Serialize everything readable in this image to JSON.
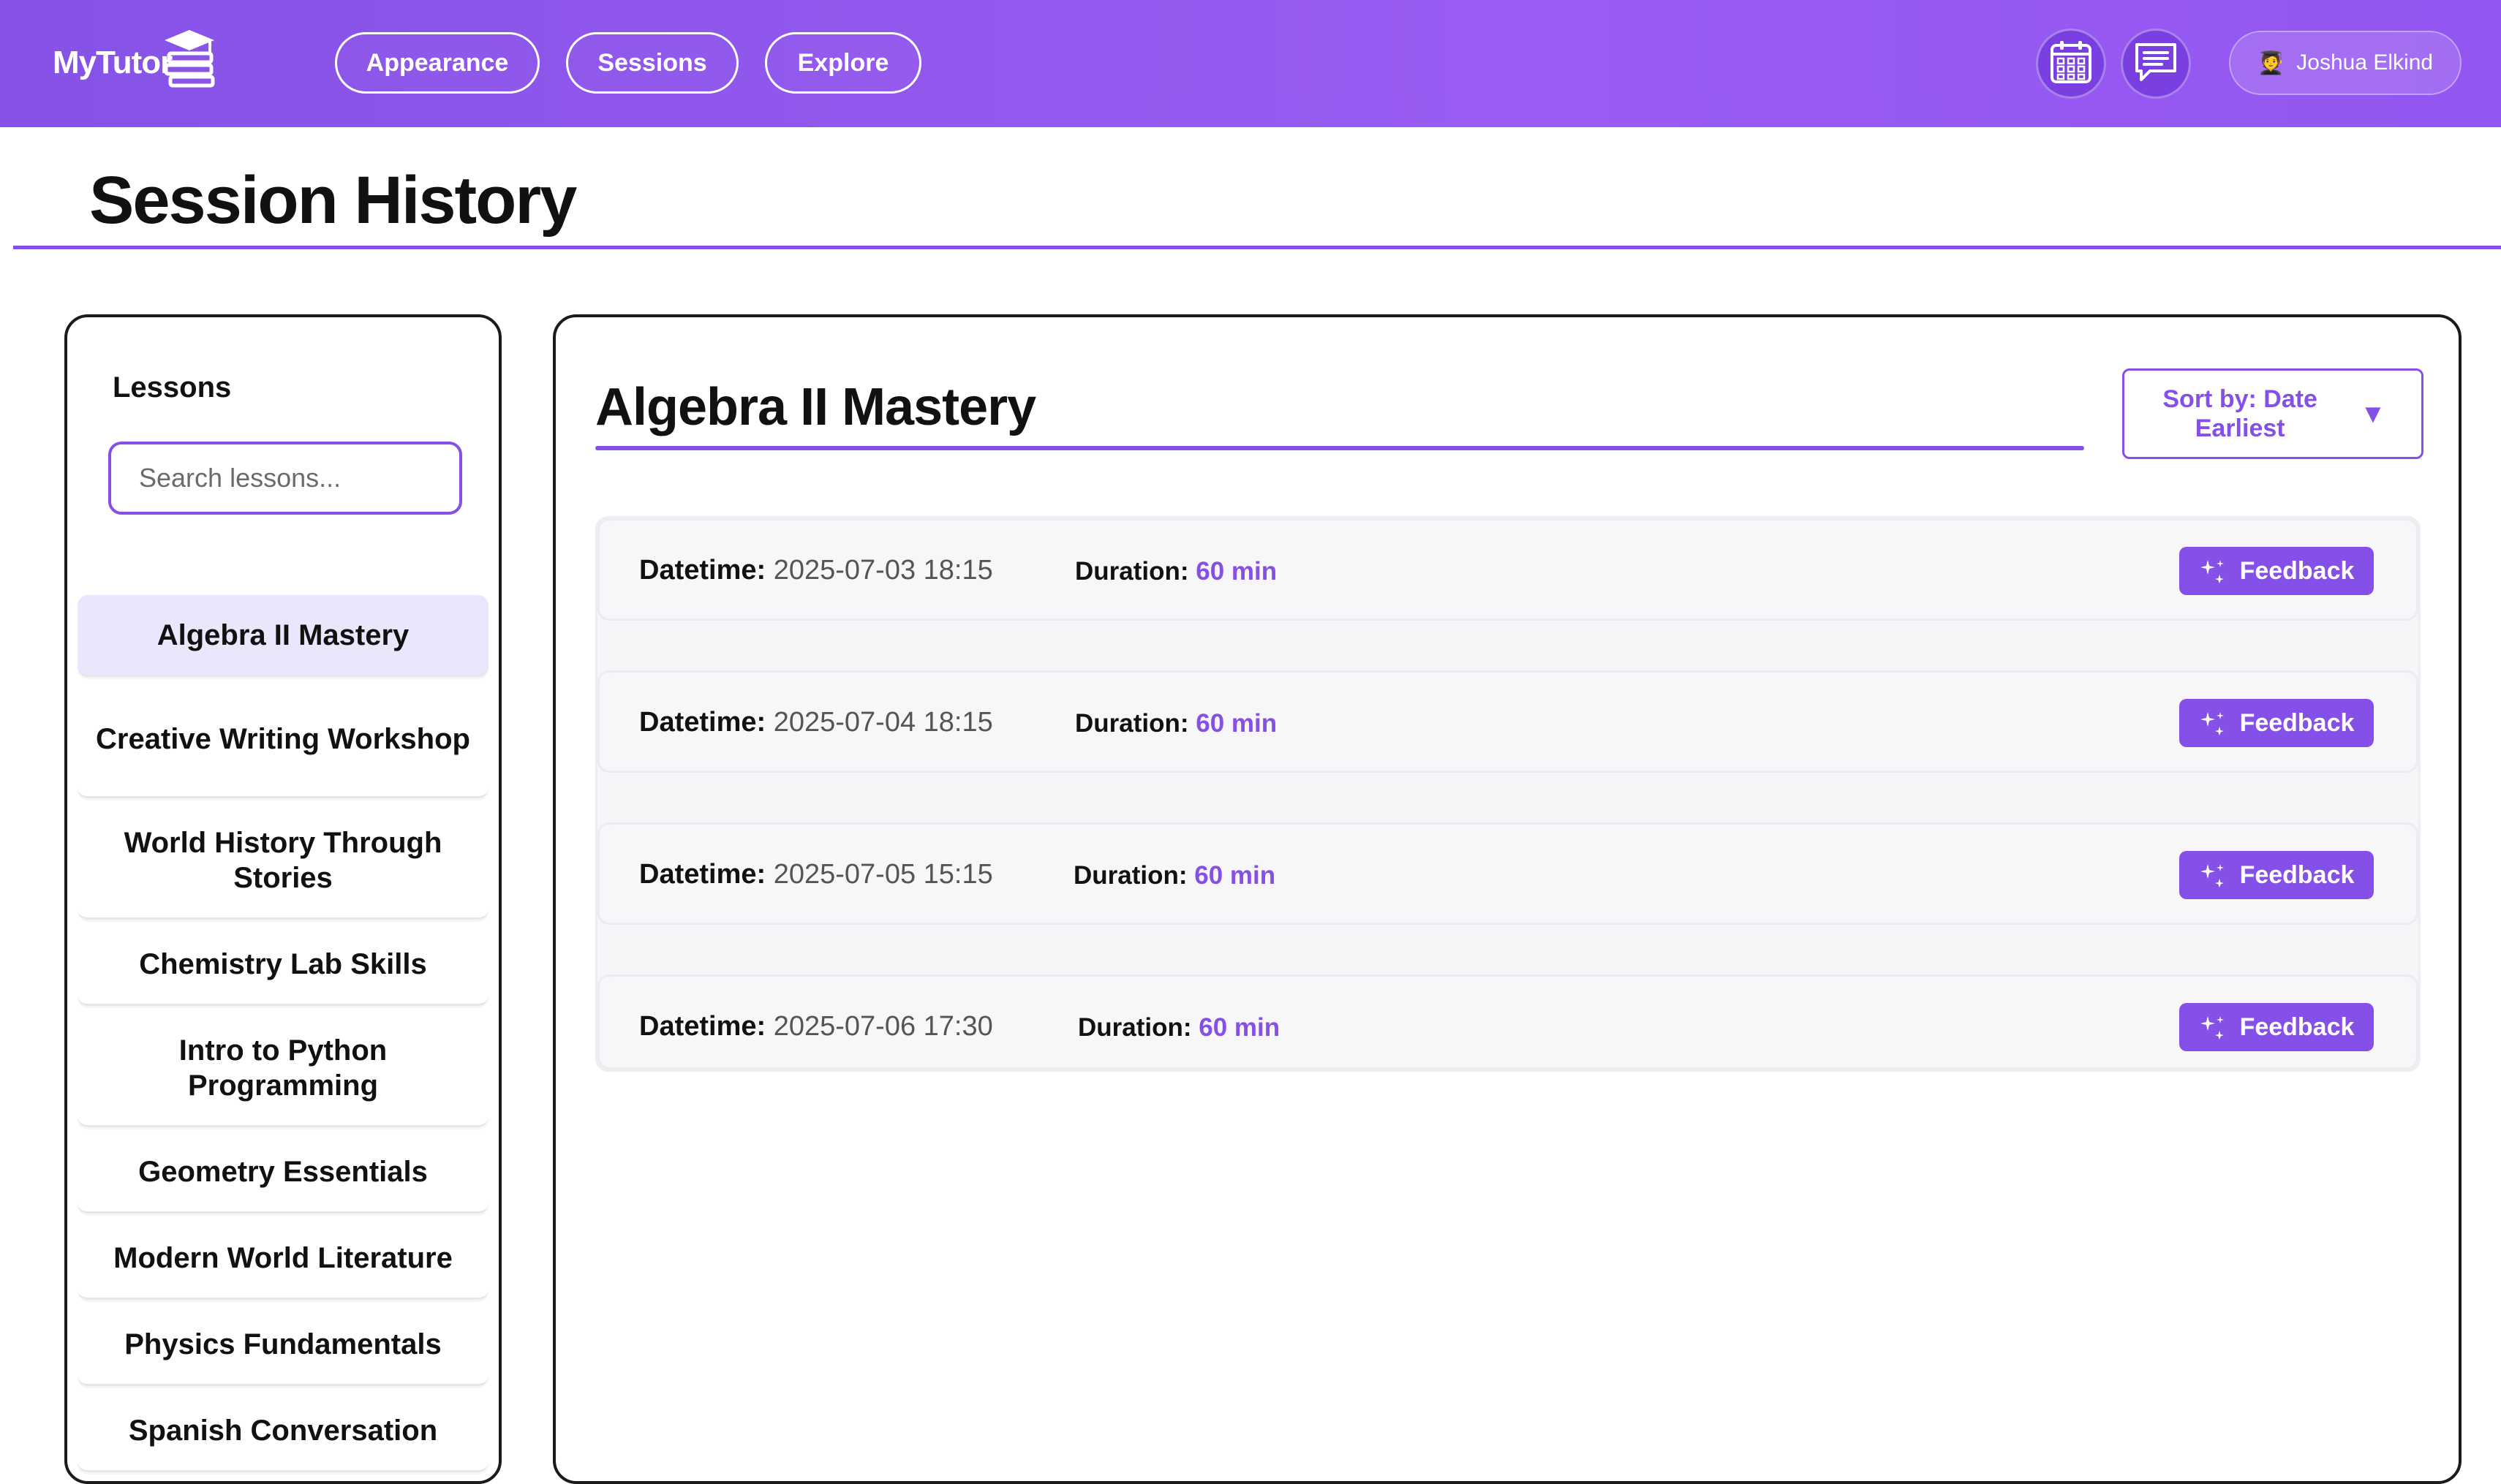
{
  "app": {
    "logo_text": "MyTutor"
  },
  "nav": {
    "links": [
      {
        "label": "Appearance"
      },
      {
        "label": "Sessions"
      },
      {
        "label": "Explore"
      }
    ],
    "icons": [
      "calendar-icon",
      "chat-icon"
    ],
    "user": {
      "avatar": "🧑‍🎓",
      "name": "Joshua Elkind"
    }
  },
  "page": {
    "title": "Session History"
  },
  "sidebar": {
    "heading": "Lessons",
    "search_placeholder": "Search lessons...",
    "items": [
      {
        "label": "Algebra II Mastery",
        "active": true
      },
      {
        "label": "Creative Writing Workshop"
      },
      {
        "label": "World History Through Stories"
      },
      {
        "label": "Chemistry Lab Skills"
      },
      {
        "label": "Intro to Python Programming"
      },
      {
        "label": "Geometry Essentials"
      },
      {
        "label": "Modern World Literature"
      },
      {
        "label": "Physics Fundamentals"
      },
      {
        "label": "Spanish Conversation"
      }
    ]
  },
  "main": {
    "course_title": "Algebra II Mastery",
    "sort": {
      "label": "Sort by: Date Earliest",
      "caret": "▼"
    },
    "datetime_label": "Datetime:",
    "duration_label": "Duration:",
    "feedback_label": "Feedback",
    "sessions": [
      {
        "datetime": "2025-07-03 18:15",
        "duration": "60 min"
      },
      {
        "datetime": "2025-07-04 18:15",
        "duration": "60 min"
      },
      {
        "datetime": "2025-07-05 15:15",
        "duration": "60 min"
      },
      {
        "datetime": "2025-07-06 17:30",
        "duration": "60 min"
      }
    ]
  },
  "colors": {
    "accent": "#8550e8",
    "nav_gradient_start": "#8652e6",
    "nav_gradient_end": "#9356f0",
    "active_lesson_bg": "#ebe6fb"
  }
}
